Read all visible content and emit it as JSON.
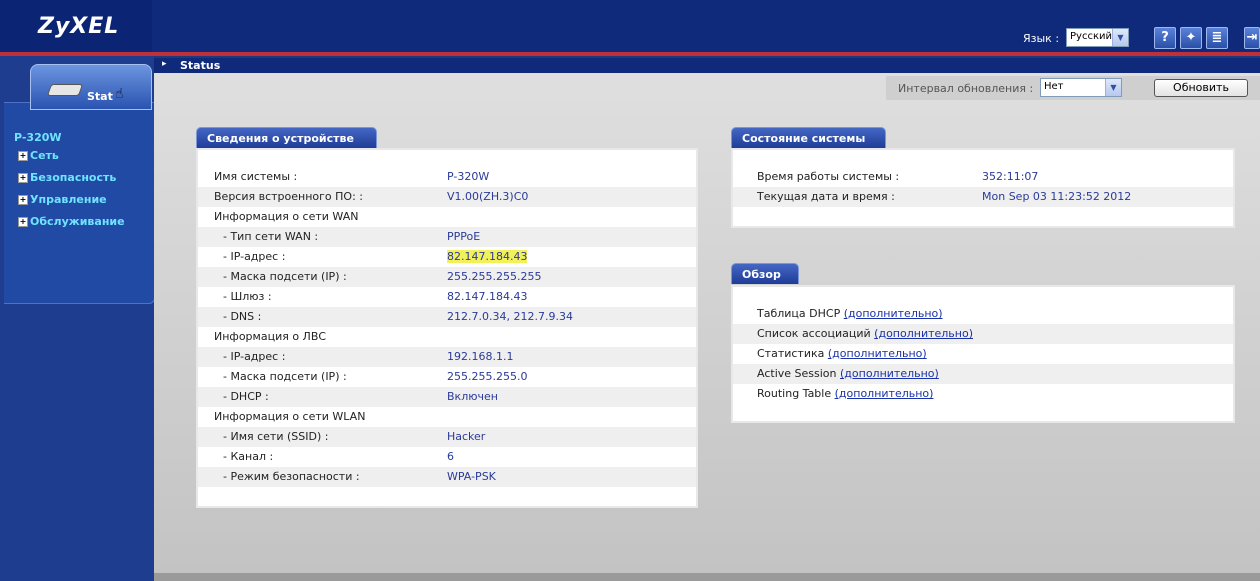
{
  "header": {
    "logo": "ZyXEL",
    "language_label": "Язык :",
    "language_value": "Русский",
    "icons": [
      "help-icon",
      "wizard-icon",
      "about-icon",
      "logout-icon"
    ],
    "icon_glyphs": {
      "help": "?",
      "wizard": "✦",
      "about": "≣",
      "logout": "⇥"
    }
  },
  "sidebar": {
    "tab_label": "Stat",
    "device": "P-320W",
    "items": [
      {
        "label": "Сеть"
      },
      {
        "label": "Безопасность"
      },
      {
        "label": "Управление"
      },
      {
        "label": "Обслуживание"
      }
    ]
  },
  "breadcrumb": "Status",
  "refresh": {
    "label": "Интервал обновления :",
    "value": "Нет",
    "button": "Обновить"
  },
  "device_info": {
    "title": "Сведения о устройстве",
    "rows": [
      {
        "label": "Имя системы :",
        "value": "P-320W",
        "indent": false
      },
      {
        "label": "Версия встроенного ПО: :",
        "value": "V1.00(ZH.3)C0",
        "indent": false
      },
      {
        "label": "Информация о сети WAN",
        "value": "",
        "indent": false
      },
      {
        "label": "- Тип сети WAN :",
        "value": "PPPoE",
        "indent": true
      },
      {
        "label": "- IP-адрес :",
        "value": "82.147.184.43",
        "indent": true,
        "highlight": true
      },
      {
        "label": "- Маска подсети (IP) :",
        "value": "255.255.255.255",
        "indent": true
      },
      {
        "label": "- Шлюз :",
        "value": "82.147.184.43",
        "indent": true
      },
      {
        "label": "- DNS :",
        "value": "212.7.0.34, 212.7.9.34",
        "indent": true
      },
      {
        "label": "Информация о ЛВС",
        "value": "",
        "indent": false
      },
      {
        "label": "- IP-адрес :",
        "value": "192.168.1.1",
        "indent": true
      },
      {
        "label": "- Маска подсети (IP) :",
        "value": "255.255.255.0",
        "indent": true
      },
      {
        "label": "- DHCP :",
        "value": "Включен",
        "indent": true
      },
      {
        "label": "Информация о сети WLAN",
        "value": "",
        "indent": false
      },
      {
        "label": "- Имя сети (SSID) :",
        "value": "Hacker",
        "indent": true
      },
      {
        "label": "- Канал :",
        "value": "6",
        "indent": true
      },
      {
        "label": "- Режим безопасности :",
        "value": "WPA-PSK",
        "indent": true
      }
    ]
  },
  "system_status": {
    "title": "Состояние системы",
    "rows": [
      {
        "label": "Время работы системы :",
        "value": "352:11:07"
      },
      {
        "label": "Текущая дата и время :",
        "value": "Mon Sep 03 11:23:52 2012"
      }
    ]
  },
  "overview": {
    "title": "Обзор",
    "rows": [
      {
        "label": "Таблица DHCP",
        "link": "(дополнительно)"
      },
      {
        "label": "Список ассоциаций",
        "link": "(дополнительно)"
      },
      {
        "label": "Статистика",
        "link": "(дополнительно)"
      },
      {
        "label": "Active Session",
        "link": "(дополнительно)"
      },
      {
        "label": "Routing Table",
        "link": "(дополнительно)"
      }
    ]
  }
}
